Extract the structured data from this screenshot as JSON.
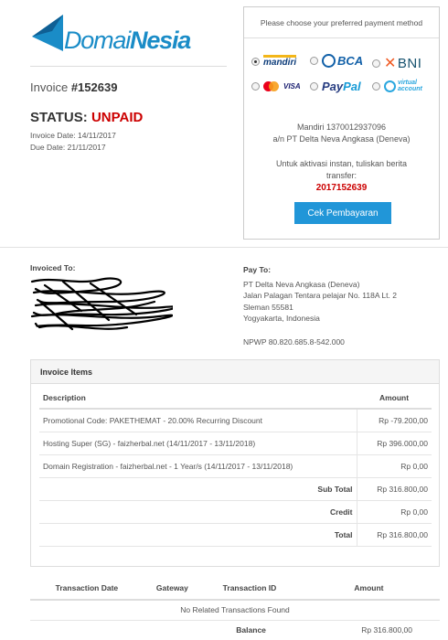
{
  "brand": {
    "name_part1": "Domai",
    "name_part2": "Nesia",
    "color": "#1a8cc7"
  },
  "invoice": {
    "label": "Invoice ",
    "number": "#152639",
    "status_label": "STATUS: ",
    "status_value": "UNPAID",
    "status_color": "#cc0000",
    "invoice_date": "Invoice Date: 14/11/2017",
    "due_date": "Due Date: 21/11/2017"
  },
  "payment": {
    "title": "Please choose your preferred payment method",
    "options": [
      {
        "name": "mandiri",
        "selected": true
      },
      {
        "name": "BCA",
        "selected": false
      },
      {
        "name": "BNI",
        "selected": false
      },
      {
        "name": "VISA",
        "selected": false
      },
      {
        "name": "PayPal",
        "selected": false
      },
      {
        "name": "virtual account",
        "selected": false
      }
    ],
    "brand_mandiri": "mandiri",
    "brand_bca": "BCA",
    "brand_bni": "BNI",
    "brand_visa": "VISA",
    "brand_paypal_a": "Pay",
    "brand_paypal_b": "Pal",
    "brand_va_1": "virtual",
    "brand_va_2": "account",
    "account_line1": "Mandiri 1370012937096",
    "account_line2": "a/n PT Delta Neva Angkasa (Deneva)",
    "instruction_line1": "Untuk aktivasi instan, tuliskan berita",
    "instruction_line2": "transfer:",
    "transfer_code": "2017152639",
    "check_button": "Cek Pembayaran",
    "button_color": "#2196d8"
  },
  "invoiced_to": {
    "label": "Invoiced To:"
  },
  "pay_to": {
    "label": "Pay To:",
    "line1": "PT Delta Neva Angkasa (Deneva)",
    "line2": "Jalan Palagan Tentara pelajar No. 118A Lt. 2",
    "line3": "Sleman 55581",
    "line4": "Yogyakarta, Indonesia",
    "npwp": "NPWP 80.820.685.8-542.000"
  },
  "items": {
    "title": "Invoice Items",
    "col_description": "Description",
    "col_amount": "Amount",
    "rows": [
      {
        "description": "Promotional Code: PAKETHEMAT - 20.00% Recurring Discount",
        "amount": "Rp -79.200,00"
      },
      {
        "description": "Hosting Super (SG) - faizherbal.net (14/11/2017 - 13/11/2018)",
        "amount": "Rp 396.000,00"
      },
      {
        "description": "Domain Registration - faizherbal.net - 1 Year/s (14/11/2017 - 13/11/2018)",
        "amount": "Rp 0,00"
      }
    ],
    "subtotal_label": "Sub Total",
    "subtotal": "Rp 316.800,00",
    "credit_label": "Credit",
    "credit": "Rp 0,00",
    "total_label": "Total",
    "total": "Rp 316.800,00"
  },
  "transactions": {
    "col_date": "Transaction Date",
    "col_gateway": "Gateway",
    "col_id": "Transaction ID",
    "col_amount": "Amount",
    "empty_text": "No Related Transactions Found",
    "balance_label": "Balance",
    "balance": "Rp 316.800,00"
  }
}
